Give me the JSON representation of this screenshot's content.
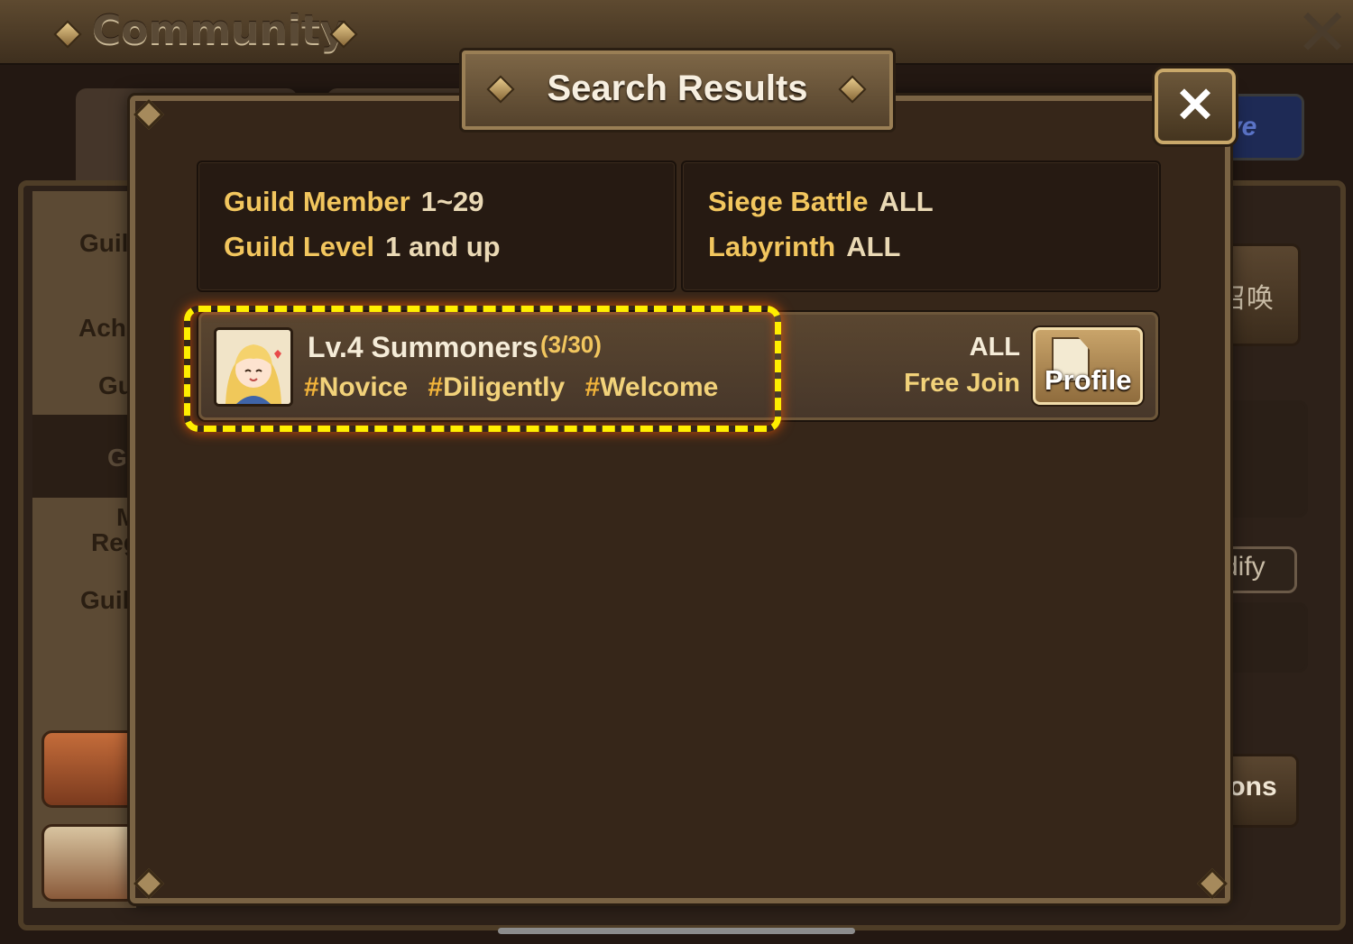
{
  "header": {
    "title": "Community",
    "close_label": "✕"
  },
  "background": {
    "left_menu": [
      "Guil",
      "Achi",
      "Gu",
      "G",
      "M",
      "Reg",
      "Guil"
    ],
    "right_labels": [
      "ve",
      "召唤",
      "dify",
      "ions"
    ]
  },
  "modal": {
    "title": "Search Results",
    "close_label": "✕",
    "filters": {
      "left": [
        {
          "label": "Guild Member",
          "value": "1~29"
        },
        {
          "label": "Guild Level",
          "value": "1 and up"
        }
      ],
      "right": [
        {
          "label": "Siege Battle",
          "value": "ALL"
        },
        {
          "label": "Labyrinth",
          "value": "ALL"
        }
      ]
    },
    "results": [
      {
        "name": "Lv.4 Summoners",
        "members": "(3/30)",
        "tags": [
          "Novice",
          "Diligently",
          "Welcome"
        ],
        "join_level": "ALL",
        "join_type": "Free Join",
        "profile_label": "Profile"
      }
    ]
  },
  "colors": {
    "accent_gold": "#f2c65e",
    "highlight": "#ffee00",
    "panel": "#362619"
  }
}
